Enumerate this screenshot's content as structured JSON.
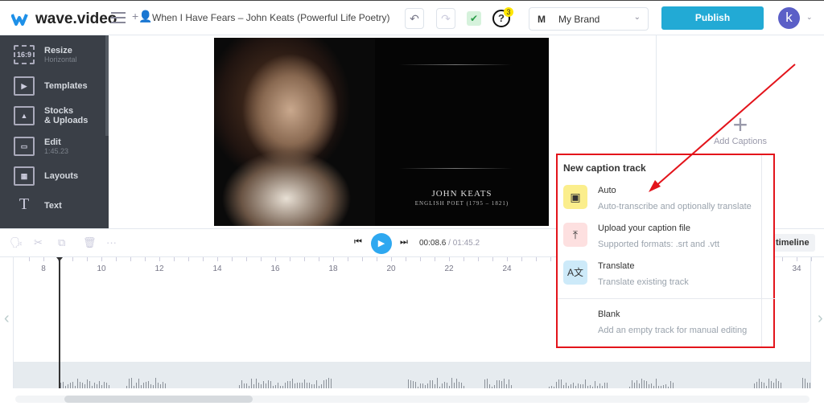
{
  "header": {
    "logo": "wave.video",
    "project_title": "When I Have Fears – John Keats (Powerful Life Poetry)",
    "help_badge": "3",
    "brand_initial": "M",
    "brand": "My Brand",
    "publish": "Publish",
    "avatar_initial": "k"
  },
  "sidebar": {
    "items": [
      {
        "label": "Resize",
        "sub": "Horizontal",
        "icon": "16:9"
      },
      {
        "label": "Templates",
        "sub": "",
        "icon": "▶"
      },
      {
        "label": "Stocks",
        "label2": "& Uploads",
        "sub": "",
        "icon": "▲"
      },
      {
        "label": "Edit",
        "sub": "1:45.23",
        "icon": "▭"
      },
      {
        "label": "Layouts",
        "sub": "",
        "icon": "▦"
      },
      {
        "label": "Text",
        "sub": "",
        "icon": "T"
      }
    ]
  },
  "video": {
    "name": "JOHN KEATS",
    "subtitle": "ENGLISH POET (1795 – 1821)"
  },
  "captions": {
    "add_label": "Add Captions"
  },
  "player": {
    "current": "00:08.6",
    "total": "/ 01:45.2",
    "timeline_btn": "timeline"
  },
  "ruler": {
    "labels": [
      "8",
      "10",
      "12",
      "14",
      "16",
      "18",
      "20",
      "22",
      "24",
      "26",
      "28",
      "30",
      "32",
      "34"
    ]
  },
  "popup": {
    "title": "New caption track",
    "items": [
      {
        "label": "Auto",
        "desc": "Auto-transcribe and optionally translate",
        "icon": "video-caption-icon",
        "color": "#fbee8c"
      },
      {
        "label": "Upload your caption file",
        "desc": "Supported formats: .srt and .vtt",
        "icon": "upload-icon",
        "color": "#fde0e0"
      },
      {
        "label": "Translate",
        "desc": "Translate existing track",
        "icon": "translate-icon",
        "color": "#cdeaf9"
      },
      {
        "label": "Blank",
        "desc": "Add an empty track for manual editing",
        "icon": "",
        "color": ""
      }
    ]
  },
  "colors": {
    "accent": "#22aad5",
    "annotation": "#e3141b",
    "sidebar": "#3a3f47"
  }
}
